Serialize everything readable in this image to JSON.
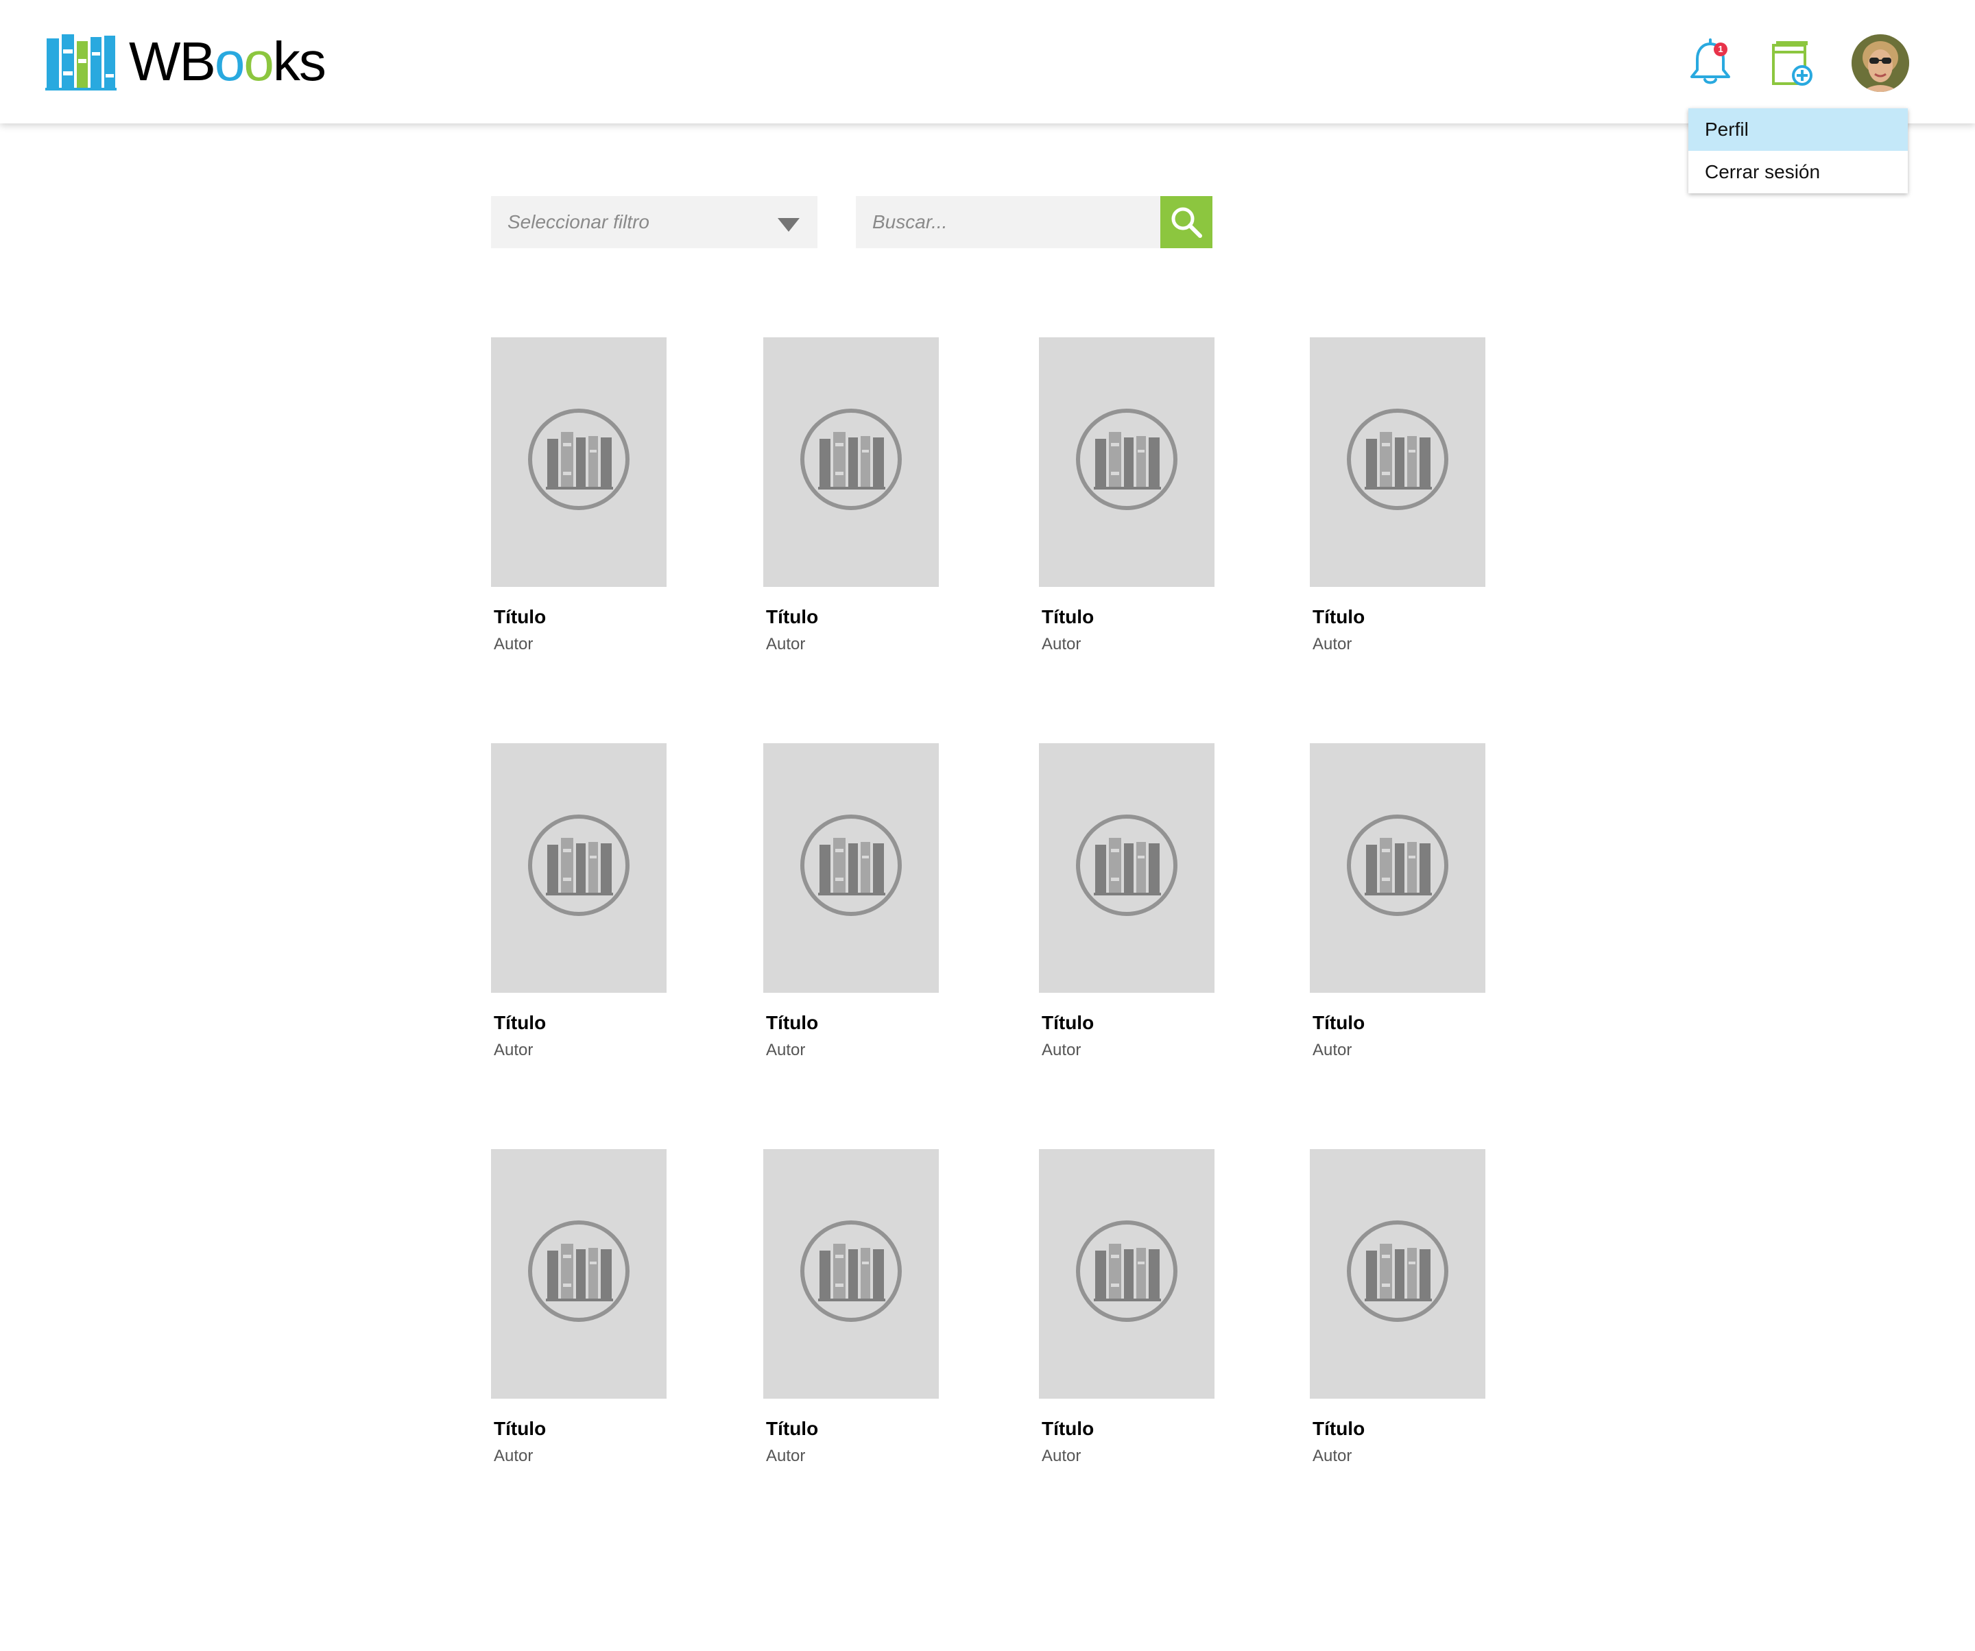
{
  "header": {
    "logo_text": "WBooks",
    "notifications_count": "1"
  },
  "user_menu": {
    "items": [
      {
        "label": "Perfil",
        "active": true
      },
      {
        "label": "Cerrar sesión",
        "active": false
      }
    ]
  },
  "toolbar": {
    "filter_placeholder": "Seleccionar filtro",
    "search_placeholder": "Buscar..."
  },
  "books": [
    {
      "title": "Título",
      "author": "Autor"
    },
    {
      "title": "Título",
      "author": "Autor"
    },
    {
      "title": "Título",
      "author": "Autor"
    },
    {
      "title": "Título",
      "author": "Autor"
    },
    {
      "title": "Título",
      "author": "Autor"
    },
    {
      "title": "Título",
      "author": "Autor"
    },
    {
      "title": "Título",
      "author": "Autor"
    },
    {
      "title": "Título",
      "author": "Autor"
    },
    {
      "title": "Título",
      "author": "Autor"
    },
    {
      "title": "Título",
      "author": "Autor"
    },
    {
      "title": "Título",
      "author": "Autor"
    },
    {
      "title": "Título",
      "author": "Autor"
    }
  ],
  "colors": {
    "brand_blue": "#29a9df",
    "brand_green": "#8cc63f",
    "badge_red": "#e8334a",
    "menu_active": "#c4e8f9"
  },
  "icons": {
    "notifications": "bell-icon",
    "add_book": "add-book-icon",
    "search": "search-icon",
    "placeholder_cover": "books-icon"
  }
}
